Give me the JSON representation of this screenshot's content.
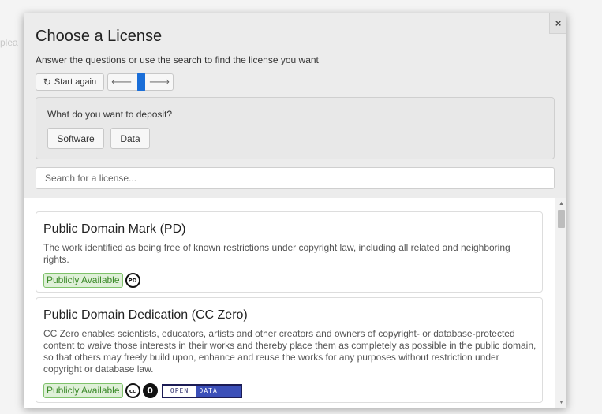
{
  "background": {
    "fragment_text": "plea"
  },
  "modal": {
    "close_label": "×",
    "title": "Choose a License",
    "subtitle": "Answer the questions or use the search to find the license you want",
    "toolbar": {
      "start_again_icon": "↻",
      "start_again_label": "Start again",
      "back_label": "🡐",
      "forward_label": "🡒"
    },
    "question": {
      "text": "What do you want to deposit?",
      "options": [
        "Software",
        "Data"
      ]
    },
    "search": {
      "placeholder": "Search for a license...",
      "value": ""
    },
    "licenses": [
      {
        "title": "Public Domain Mark (PD)",
        "description": "The work identified as being free of known restrictions under copyright law, including all related and neighboring rights.",
        "badge": "Publicly Available",
        "icons": [
          "pd-icon"
        ],
        "icon_labels": [
          "PD"
        ]
      },
      {
        "title": "Public Domain Dedication (CC Zero)",
        "description": "CC Zero enables scientists, educators, artists and other creators and owners of copyright- or database-protected content to waive those interests in their works and thereby place them as completely as possible in the public domain, so that others may freely build upon, enhance and reuse the works for any purposes without restriction under copyright or database law.",
        "badge": "Publicly Available",
        "icons": [
          "cc-icon",
          "zero-icon",
          "open-data-badge"
        ],
        "icon_labels": [
          "cc",
          "0"
        ],
        "open_data_labels": [
          "OPEN",
          "DATA"
        ]
      }
    ],
    "scrollbar": {
      "up_arrow": "▲",
      "down_arrow": "▼"
    }
  },
  "colors": {
    "accent": "#1a6ed8",
    "badge_bg": "#dff0d8",
    "badge_text": "#3c8a2a",
    "open_data_blue": "#3b4fb8"
  }
}
